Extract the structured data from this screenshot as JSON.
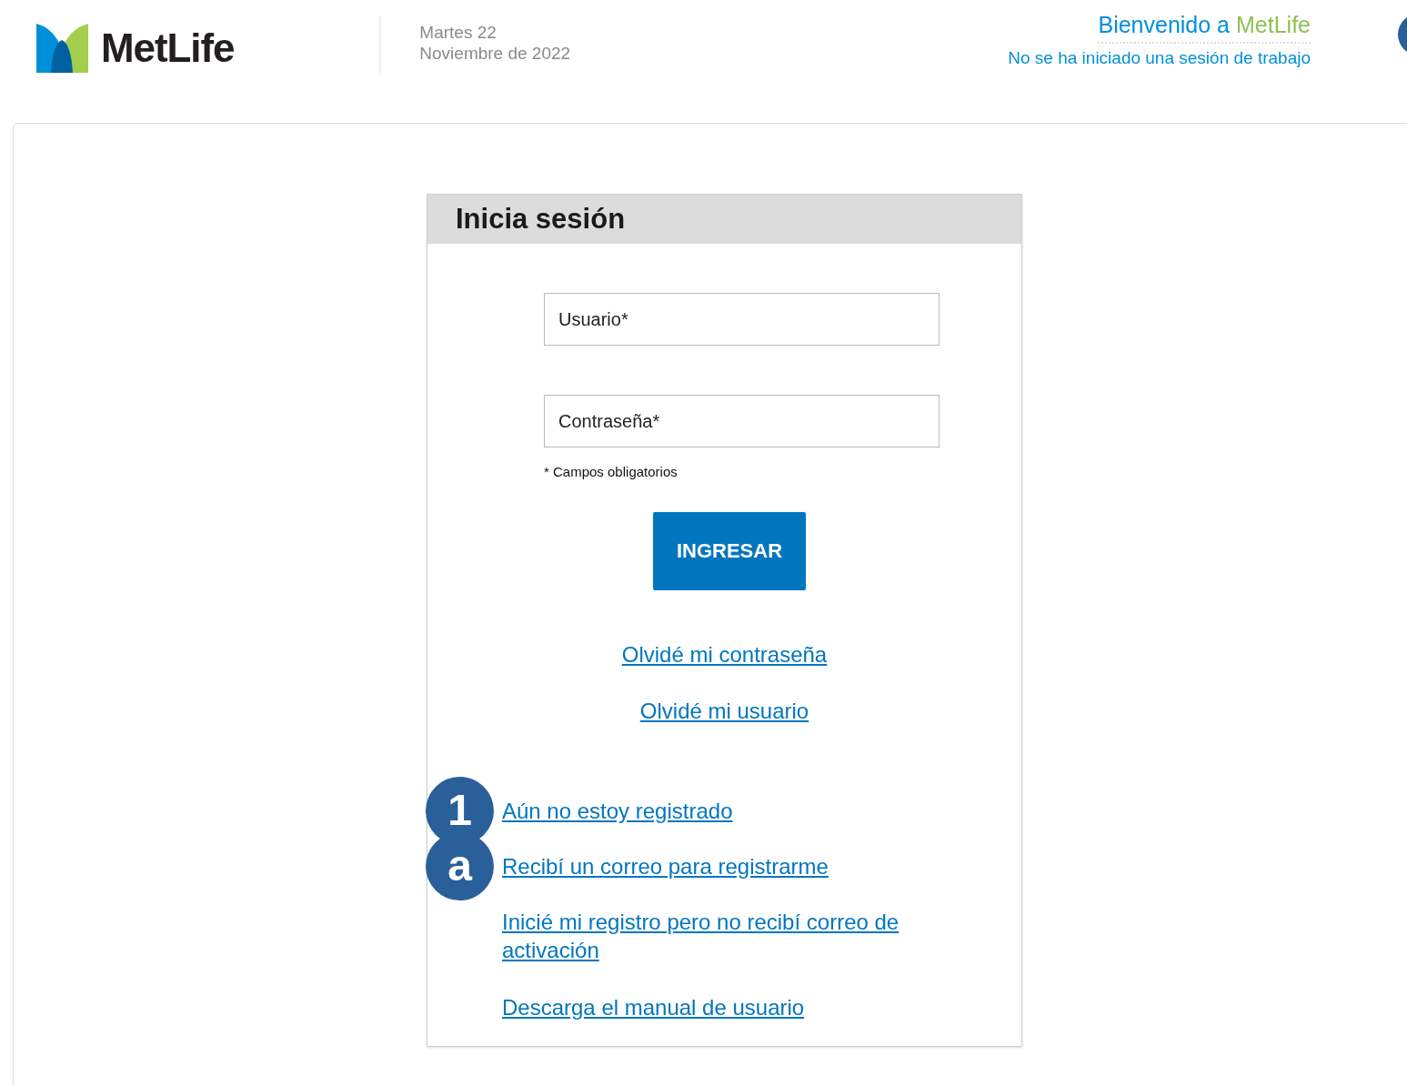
{
  "header": {
    "logo_text": "MetLife",
    "date_line_1": "Martes 22",
    "date_line_2": "Noviembre de 2022",
    "welcome_prefix": "Bienvenido a",
    "welcome_brand": "MetLife",
    "session_status": "No se ha iniciado una sesión de trabajo"
  },
  "login": {
    "title": "Inicia sesión",
    "fields": [
      {
        "placeholder": "Usuario*"
      },
      {
        "placeholder": "Contraseña*"
      }
    ],
    "required_note": "* Campos obligatorios",
    "submit": "INGRESAR",
    "recovery_links": [
      "Olvidé mi contraseña",
      "Olvidé mi usuario"
    ],
    "register_links": [
      {
        "text": "Aún no estoy registrado",
        "callout": "1"
      },
      {
        "text": "Recibí un correo para registrarme",
        "callout": "a"
      },
      {
        "text": "Inicié mi registro pero no recibí correo de activación"
      },
      {
        "text": "Descarga el manual de usuario"
      }
    ]
  }
}
